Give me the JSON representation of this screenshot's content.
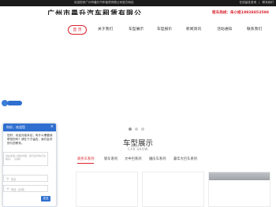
{
  "topbar": {
    "welcome": "欢迎您来广州市晨升汽车租赁有限公司官方网站",
    "link_online": "在线留言咨询",
    "link_contact": "联系我们"
  },
  "brand": {
    "name": "广州市晨升汽车租赁有限公司",
    "phone": "租车热线：朱小姐18928853598"
  },
  "nav": {
    "items": [
      "首 页",
      "关于我们",
      "车型展示",
      "车型报价",
      "新闻资讯",
      "活动通知",
      "联系我们"
    ]
  },
  "section": {
    "title": "车型展示",
    "subtitle": "CAR SHOW",
    "tabs": [
      "商务车系列",
      "轿车系列",
      "大中巴系列",
      "婚庆车系列",
      "豪华大巴车系列"
    ]
  },
  "chat": {
    "title": "你好，欢迎您",
    "message": "您好，欢迎光临本站，有什么需要我帮您的吗？请在下方留言，我们会尽快与您联系。",
    "textarea_placeholder": "请在此输入留言内容，我们会尽快与您联系。（必填）",
    "name_placeholder": "姓名",
    "phone_placeholder": "电话（必填）",
    "send_label": "发送"
  },
  "colors": {
    "accent": "#d9232d",
    "chat_blue": "#2f6fd0",
    "topbar": "#1b1b1b"
  }
}
